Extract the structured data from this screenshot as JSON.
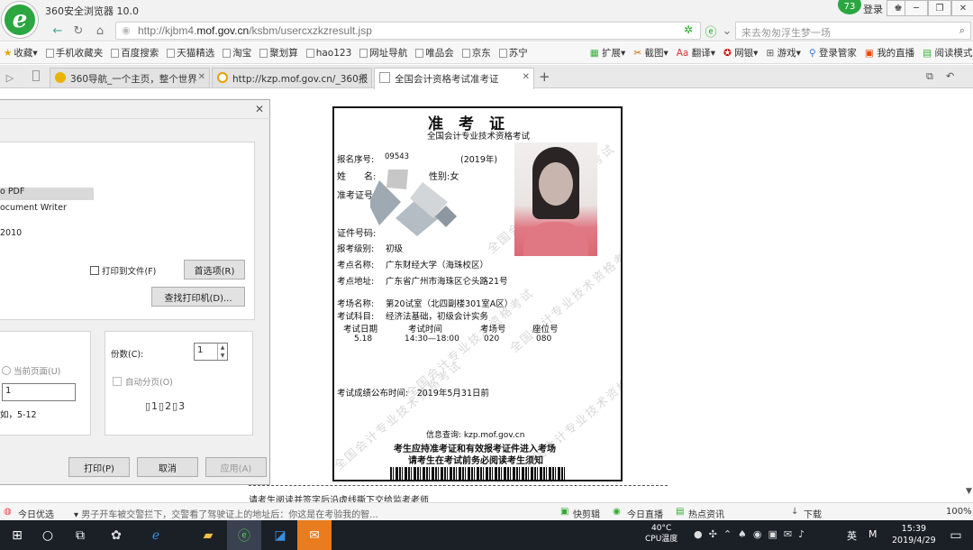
{
  "window": {
    "app_title": "360安全浏览器 10.0",
    "notif_count": "73",
    "login": "登录"
  },
  "address": {
    "url_pre": "http://kjbm4.",
    "url_host": "mof.gov.cn",
    "url_post": "/ksbm/usercxzkzresult.jsp",
    "search_placeholder": "来去匆匆浮生梦一场"
  },
  "bookmarks": [
    "收藏",
    "手机收藏夹",
    "百度搜索",
    "天猫精选",
    "淘宝",
    "聚划算",
    "hao123",
    "网址导航",
    "唯品会",
    "京东",
    "苏宁"
  ],
  "toolbar": [
    "扩展",
    "截图",
    "翻译",
    "网银",
    "游戏",
    "登录管家",
    "我的直播",
    "阅读模式"
  ],
  "tabs": [
    {
      "label": "360导航_一个主页，整个世界",
      "color": "#e8b400"
    },
    {
      "label": "http://kzp.mof.gov.cn/_360报",
      "color": "#e8a000"
    },
    {
      "label": "全国会计资格考试准考证",
      "color": "#bbbbbb"
    }
  ],
  "dialog": {
    "printers": [
      "o PDF",
      "ocument Writer",
      "2010"
    ],
    "print_to_file": "打印到文件(F)",
    "preferences": "首选项(R)",
    "find_printer": "查找打印机(D)...",
    "current_page": "当前页面(U)",
    "pages_value": "1",
    "example": "如，5-12",
    "copies_label": "份数(C):",
    "copies_value": "1",
    "collate": "自动分页(O)",
    "print": "打印(P)",
    "cancel": "取消",
    "apply": "应用(A)"
  },
  "ticket": {
    "title": "准　考　证",
    "subtitle": "全国会计专业技术资格考试",
    "serial_label": "报名序号:",
    "serial": "09543",
    "year": "(2019年)",
    "name_label": "姓　　名:",
    "gender": "性别:女",
    "exam_no_label": "准考证号:",
    "id_label": "证件号码:",
    "level_label": "报考级别:",
    "level": "初级",
    "site_label": "考点名称:",
    "site": "广东财经大学（海珠校区）",
    "addr_label": "考点地址:",
    "addr": "广东省广州市海珠区仑头路21号",
    "room_label": "考场名称:",
    "room": "第20试室（北四副楼301室A区）",
    "subject_label": "考试科目:",
    "subject": "经济法基础，初级会计实务",
    "col_date": "考试日期",
    "col_time": "考试时间",
    "col_room": "考场号",
    "col_seat": "座位号",
    "date": "5.18",
    "time": "14:30—18:00",
    "room_no": "020",
    "seat_no": "080",
    "result_date": "考试成绩公布时间:　2019年5月31日前",
    "query": "信息查询: kzp.mof.gov.cn",
    "notice1": "考生应持准考证和有效报考证件进入考场",
    "notice2": "请考生在考试前务必阅读考生须知",
    "watermark": "全国会计专业技术资格考试"
  },
  "below_ticket": "请考生阅读并签字后沿虚线撕下交给监考老师",
  "statusbar": {
    "left": "今日优选",
    "news": "男子开车被交警拦下，交警看了驾驶证上的地址后：你这是在考验我的智...",
    "items": [
      "快剪辑",
      "今日直播",
      "热点资讯",
      "下载"
    ],
    "zoom": "100%"
  },
  "taskbar": {
    "temp": "40°C",
    "temp_label": "CPU温度",
    "ime": "英",
    "time": "15:39",
    "date": "2019/4/29"
  }
}
